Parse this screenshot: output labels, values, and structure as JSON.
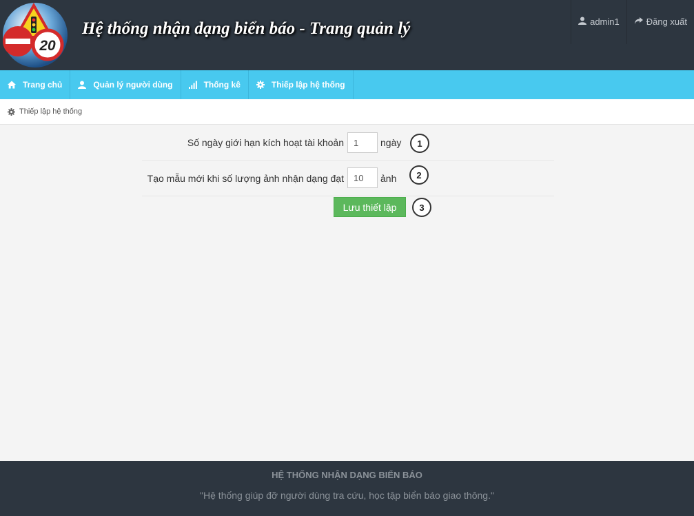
{
  "header": {
    "title": "Hệ thống nhận dạng biển báo - Trang quản lý",
    "logo_sign_text": "20",
    "user_label": "admin1",
    "logout_label": "Đăng xuất"
  },
  "nav": {
    "items": [
      {
        "label": "Trang chủ",
        "icon": "home-icon"
      },
      {
        "label": "Quản lý người dùng",
        "icon": "user-icon"
      },
      {
        "label": "Thống kê",
        "icon": "bar-chart-icon"
      },
      {
        "label": "Thiếp lập hệ thống",
        "icon": "gear-icon"
      }
    ]
  },
  "breadcrumb": {
    "label": "Thiếp lập hệ thống",
    "icon": "gear-icon"
  },
  "form": {
    "row1": {
      "label": "Số ngày giới hạn kích hoạt tài khoản",
      "value": "1",
      "unit": "ngày",
      "step": "1"
    },
    "row2": {
      "label": "Tạo mẫu mới khi số lượng ảnh nhận dạng đạt",
      "value": "10",
      "unit": "ảnh",
      "step": "2"
    },
    "save": {
      "label": "Lưu thiết lập",
      "step": "3"
    }
  },
  "footer": {
    "title": "HỆ THỐNG NHẬN DẠNG BIỂN BÁO",
    "text": "\"Hệ thống giúp đỡ người dùng tra cứu, học tập biển báo giao thông.\""
  },
  "colors": {
    "header_bg": "#2d3640",
    "nav_bg": "#48c9ef",
    "save_button": "#5cb85c",
    "page_bg": "#f4f4f4"
  }
}
